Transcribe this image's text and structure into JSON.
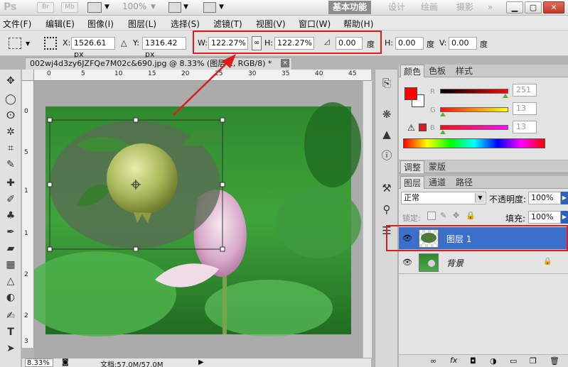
{
  "app": {
    "logo": "Ps",
    "badges": [
      "Br",
      "Mb"
    ],
    "zoom": "100%",
    "workspaces": [
      {
        "label": "基本功能",
        "active": true
      },
      {
        "label": "设计"
      },
      {
        "label": "绘画"
      },
      {
        "label": "摄影"
      }
    ],
    "more": "»"
  },
  "menu": [
    "文件(F)",
    "编辑(E)",
    "图像(I)",
    "图层(L)",
    "选择(S)",
    "滤镜(T)",
    "视图(V)",
    "窗口(W)",
    "帮助(H)"
  ],
  "options": {
    "x_label": "X:",
    "x_value": "1526.61 px",
    "delta": "△",
    "y_label": "Y:",
    "y_value": "1316.42 px",
    "w_label": "W:",
    "w_value": "122.27%",
    "h_label": "H:",
    "h_value": "122.27%",
    "angle_value": "0.00",
    "deg": "度",
    "hskew_label": "H:",
    "hskew_value": "0.00",
    "vskew_label": "V:",
    "vskew_value": "0.00"
  },
  "document": {
    "tab_title": "002wj4d3zy6JZFQe7M02c&690.jpg @ 8.33% (图层 1, RGB/8) *",
    "close": "×",
    "zoom": "8.33%",
    "doc_size": "文档:57.0M/57.0M",
    "ruler_h": [
      "0",
      "5",
      "10",
      "15",
      "20",
      "25",
      "30",
      "35",
      "40",
      "45"
    ],
    "ruler_v": [
      "0",
      "5",
      "1",
      "1",
      "2",
      "2",
      "3"
    ]
  },
  "color_panel": {
    "tabs": [
      {
        "label": "颜色",
        "active": true
      },
      {
        "label": "色板"
      },
      {
        "label": "样式"
      }
    ],
    "foreground": "#ff0000",
    "background": "#ffffff",
    "channels": [
      {
        "label": "R",
        "value": "251",
        "fraction": 0.98
      },
      {
        "label": "G",
        "value": "13",
        "fraction": 0.05
      },
      {
        "label": "B",
        "value": "13",
        "fraction": 0.05
      }
    ],
    "warning": "⚠"
  },
  "adjust_panel": {
    "tabs": [
      {
        "label": "调整",
        "active": true
      },
      {
        "label": "蒙版"
      }
    ]
  },
  "layers_panel": {
    "tabs": [
      {
        "label": "图层",
        "active": true
      },
      {
        "label": "通道"
      },
      {
        "label": "路径"
      }
    ],
    "blend_mode": "正常",
    "opacity_label": "不透明度:",
    "opacity_value": "100%",
    "lock_label": "锁定:",
    "fill_label": "填充:",
    "fill_value": "100%",
    "layers": [
      {
        "name": "图层 1",
        "selected": true
      },
      {
        "name": "背景",
        "locked": true
      }
    ],
    "footer_icons": [
      "link-icon",
      "fx-icon",
      "mask-icon",
      "adjustment-icon",
      "folder-icon",
      "new-layer-icon",
      "trash-icon"
    ]
  }
}
